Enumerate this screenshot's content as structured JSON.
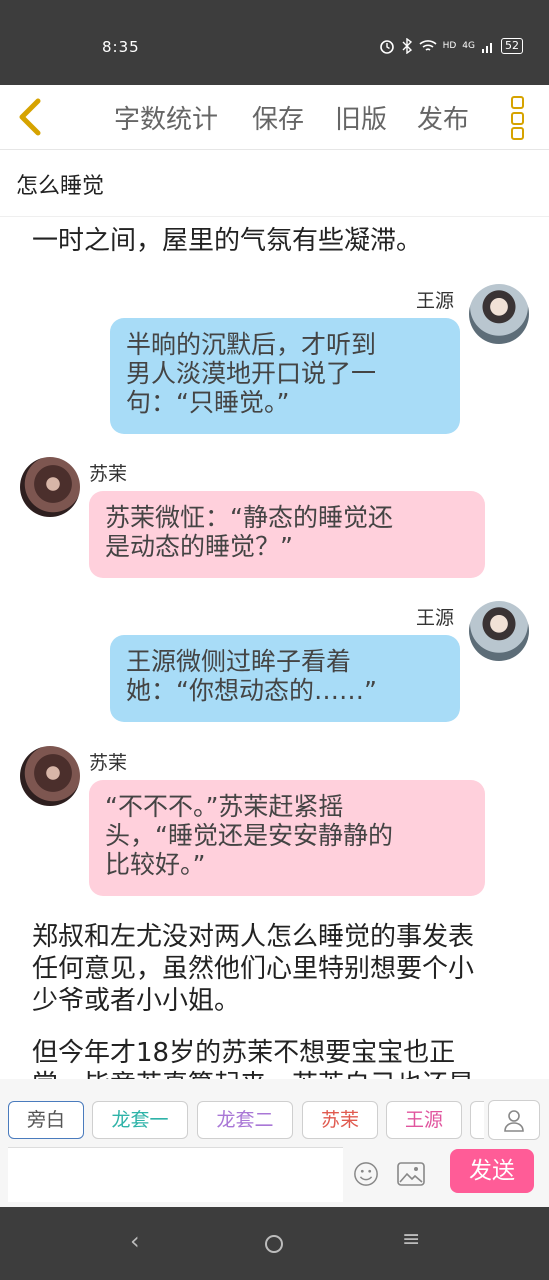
{
  "status": {
    "time": "8:35",
    "network": "4G",
    "hd": "HD",
    "battery": "52"
  },
  "toolbar": {
    "items": [
      "字数统计",
      "保存",
      "旧版",
      "发布"
    ]
  },
  "page_title": "怎么睡觉",
  "messages": {
    "m0": "一时之间，屋里的气氛有些凝滞。",
    "m1_name": "王源",
    "m1_l1": "半晌的沉默后，才听到",
    "m1_l2": "男人淡漠地开口说了一",
    "m1_l3": "句：“只睡觉。”",
    "m2_name": "苏茉",
    "m2_l1": "苏茉微怔：“静态的睡觉还",
    "m2_l2": "是动态的睡觉？”",
    "m3_name": "王源",
    "m3_l1": "王源微侧过眸子看着",
    "m3_l2": "她：“你想动态的……”",
    "m4_name": "苏茉",
    "m4_l1": "“不不不。”苏茉赶紧摇",
    "m4_l2": "头，“睡觉还是安安静静的",
    "m4_l3": "比较好。”",
    "m5_l1": "郑叔和左尤没对两人怎么睡觉的事发表",
    "m5_l2": "任何意见，虽然他们心里特别想要个小",
    "m5_l3": "少爷或者小小姐。",
    "m6_l1": "但今年才18岁的苏茉不想要宝宝也正",
    "m6_l2": "常，毕竟若真算起来，苏茉自己也还是"
  },
  "roles": {
    "narrator": "旁白",
    "extra1": "龙套一",
    "extra2": "龙套二",
    "role_a": "苏茉",
    "role_b": "王源"
  },
  "role_colors": {
    "narrator": "#4a7bbd",
    "extra1": "#2fb3a8",
    "extra2": "#a977d6",
    "role_a": "#e05a4f",
    "role_b": "#e0559e"
  },
  "input": {
    "send_label": "发送"
  },
  "colors": {
    "accent": "#d6a300",
    "send": "#ff5c97",
    "bubble_blue": "#a8dcf7",
    "bubble_pink": "#ffd0dc"
  },
  "icons": [
    "back-arrow-icon",
    "more-menu-icon",
    "user-icon",
    "emoji-icon",
    "image-icon",
    "nav-back-icon",
    "nav-home-icon",
    "nav-menu-icon"
  ]
}
